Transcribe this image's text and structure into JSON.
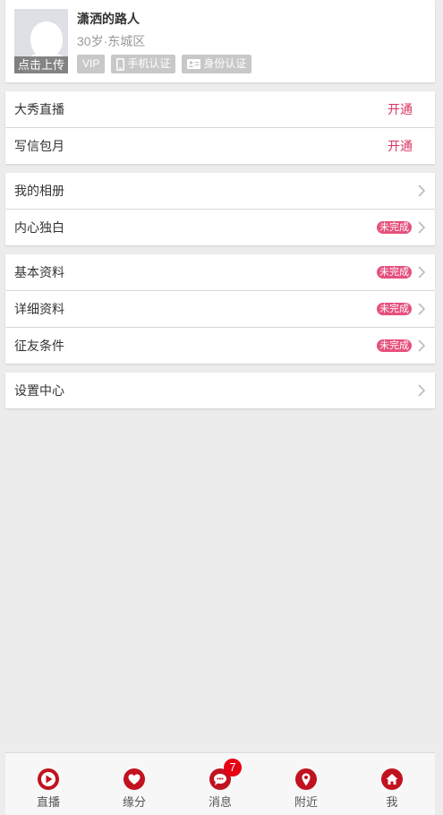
{
  "profile": {
    "upload_label": "点击上传",
    "name": "潇洒的路人",
    "info": "30岁·东城区",
    "badges": [
      "VIP",
      "手机认证",
      "身份认证"
    ]
  },
  "vip_rows": [
    {
      "label": "大秀直播",
      "action": "开通"
    },
    {
      "label": "写信包月",
      "action": "开通"
    }
  ],
  "album_rows": [
    {
      "label": "我的相册",
      "status": ""
    },
    {
      "label": "内心独白",
      "status": "未完成"
    }
  ],
  "info_rows": [
    {
      "label": "基本资料",
      "status": "未完成"
    },
    {
      "label": "详细资料",
      "status": "未完成"
    },
    {
      "label": "征友条件",
      "status": "未完成"
    }
  ],
  "settings_rows": [
    {
      "label": "设置中心"
    }
  ],
  "tabs": [
    {
      "label": "直播",
      "icon": "play-icon"
    },
    {
      "label": "缘分",
      "icon": "heart-icon"
    },
    {
      "label": "消息",
      "icon": "message-icon",
      "badge": "7"
    },
    {
      "label": "附近",
      "icon": "location-pin-icon"
    },
    {
      "label": "我",
      "icon": "home-icon"
    }
  ],
  "colors": {
    "accent": "#d9355f",
    "incomplete_badge": "#e5507c",
    "icon_red": "#c1121f",
    "notification": "#e60012"
  }
}
